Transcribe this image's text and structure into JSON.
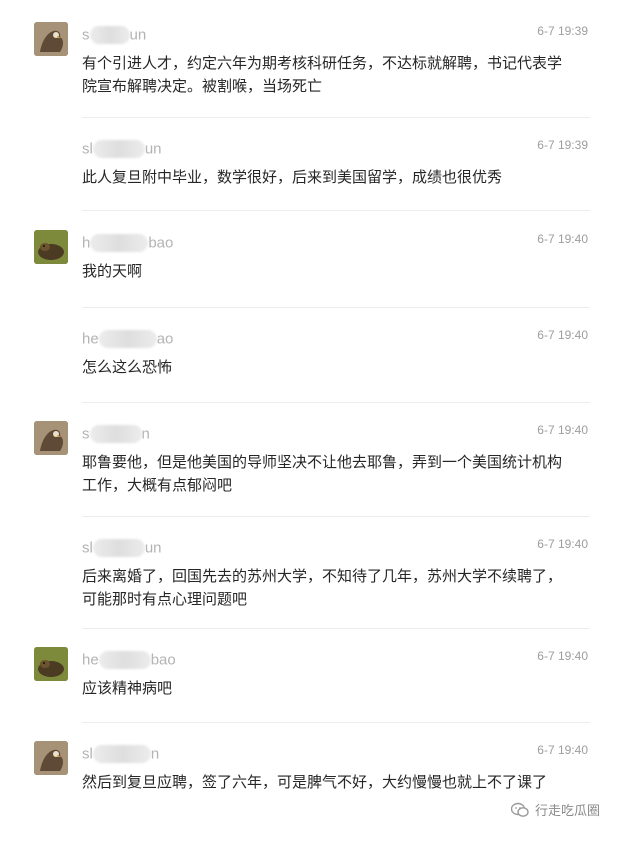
{
  "messages": [
    {
      "avatar": "user-s-avatar",
      "name_start": "s",
      "name_end": "un",
      "time": "6-7 19:39",
      "text": "有个引进人才，约定六年为期考核科研任务，不达标就解聘，书记代表学院宣布解聘决定。被割喉，当场死亡"
    },
    {
      "avatar": "",
      "name_start": "sl",
      "name_end": "un",
      "time": "6-7 19:39",
      "text": "此人复旦附中毕业，数学很好，后来到美国留学，成绩也很优秀"
    },
    {
      "avatar": "user-h-avatar",
      "name_start": "h",
      "name_end": "bao",
      "time": "6-7 19:40",
      "text": "我的天啊"
    },
    {
      "avatar": "",
      "name_start": "he",
      "name_end": "ao",
      "time": "6-7 19:40",
      "text": "怎么这么恐怖"
    },
    {
      "avatar": "user-s-avatar",
      "name_start": "s",
      "name_end": "n",
      "time": "6-7 19:40",
      "text": "耶鲁要他，但是他美国的导师坚决不让他去耶鲁，弄到一个美国统计机构工作，大概有点郁闷吧"
    },
    {
      "avatar": "",
      "name_start": "sl",
      "name_end": "un",
      "time": "6-7 19:40",
      "text": "后来离婚了，回国先去的苏州大学，不知待了几年，苏州大学不续聘了，可能那时有点心理问题吧"
    },
    {
      "avatar": "user-h-avatar",
      "name_start": "he",
      "name_end": "bao",
      "time": "6-7 19:40",
      "text": "应该精神病吧"
    },
    {
      "avatar": "user-s-avatar",
      "name_start": "sl",
      "name_end": "n",
      "time": "6-7 19:40",
      "text": "然后到复旦应聘，签了六年，可是脾气不好，大约慢慢也就上不了课了"
    }
  ],
  "watermark": {
    "icon": "wechat-channel-icon",
    "text": "行走吃瓜圈"
  }
}
